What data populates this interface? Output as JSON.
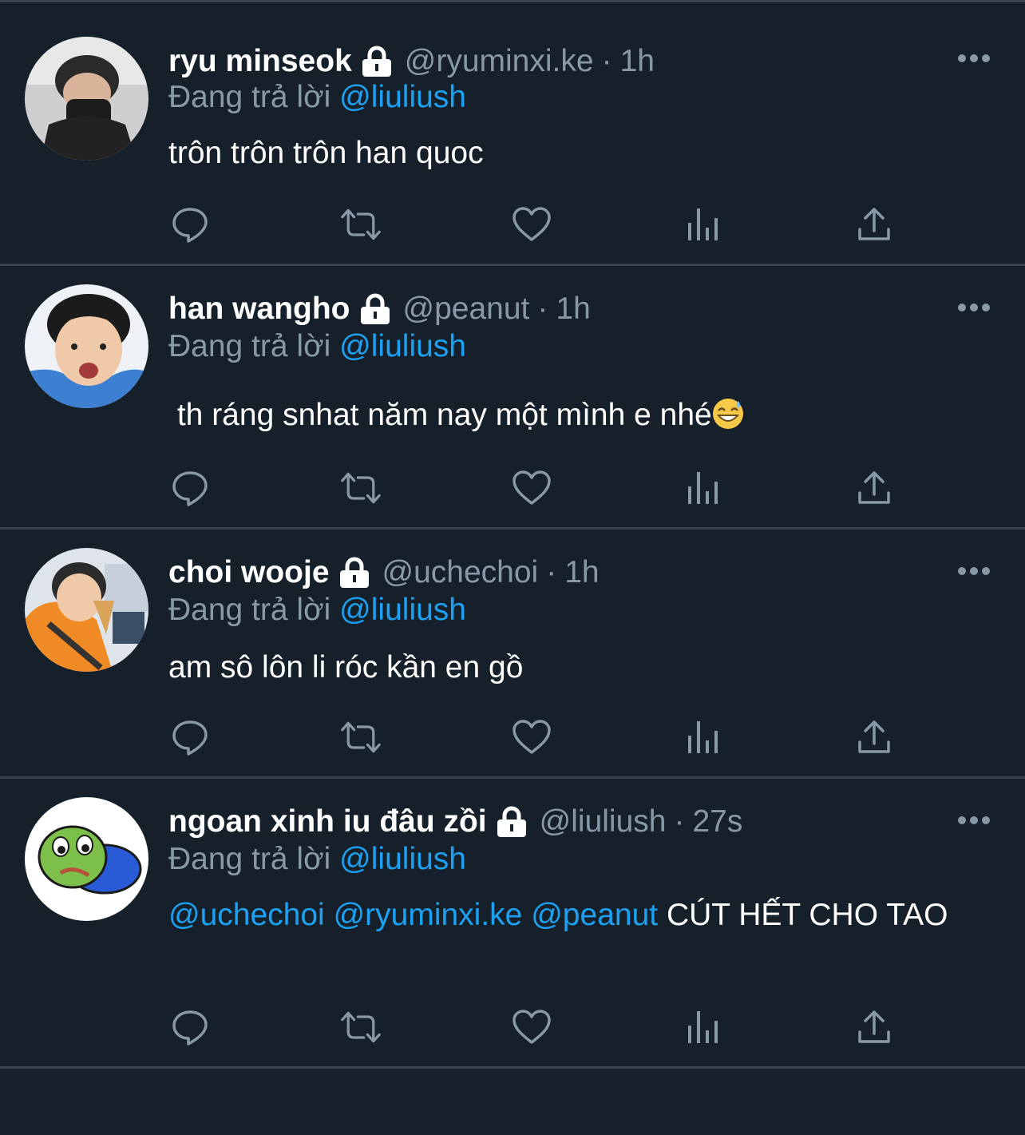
{
  "tweets": [
    {
      "name": "ryu minseok",
      "handle": "@ryuminxi.ke",
      "separator": "·",
      "time": "1h",
      "reply_prefix": "Đang trả lời",
      "reply_mention": "@liuliush",
      "text": "trôn trôn trôn han quoc"
    },
    {
      "name": "han wangho",
      "handle": "@peanut",
      "separator": "·",
      "time": "1h",
      "reply_prefix": "Đang trả lời",
      "reply_mention": "@liuliush",
      "text": " th ráng snhat năm nay một mình e nhé",
      "emoji": "grinning-face-with-sweat"
    },
    {
      "name": "choi wooje",
      "handle": "@uchechoi",
      "separator": "·",
      "time": "1h",
      "reply_prefix": "Đang trả lời",
      "reply_mention": "@liuliush",
      "text": "am sô lôn li róc kần en gồ"
    },
    {
      "name": "ngoan xinh iu đâu zồi",
      "handle": "@liuliush",
      "separator": "·",
      "time": "27s",
      "reply_prefix": "Đang trả lời",
      "reply_mention": "@liuliush",
      "mentions": [
        "@uchechoi",
        "@ryuminxi.ke",
        "@peanut"
      ],
      "text": "CÚT HẾT CHO TAO"
    }
  ],
  "icons": {
    "lock": "lock-icon",
    "more": "more-options-icon",
    "reply": "reply-icon",
    "retweet": "retweet-icon",
    "like": "like-icon",
    "analytics": "analytics-icon",
    "share": "share-icon"
  },
  "colors": {
    "background": "#15202b",
    "divider": "#38444d",
    "text": "#ffffff",
    "secondary": "#8899a6",
    "accent": "#1da1f2"
  }
}
